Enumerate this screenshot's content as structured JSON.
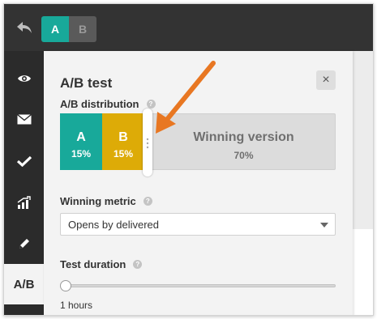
{
  "toolbar": {
    "version_a": "A",
    "version_b": "B"
  },
  "sidebar": {
    "items": [
      {
        "icon": "eye-icon"
      },
      {
        "icon": "envelope-icon"
      },
      {
        "icon": "checkmark-icon"
      },
      {
        "icon": "chart-icon"
      },
      {
        "icon": "pencil-icon"
      },
      {
        "label": "A/B"
      }
    ]
  },
  "panel": {
    "title": "A/B test",
    "close": "×",
    "distribution_label": "A/B distribution",
    "segments": {
      "a_label": "A",
      "a_percent": "15%",
      "b_label": "B",
      "b_percent": "15%",
      "winning_label": "Winning version",
      "winning_percent": "70%"
    },
    "winning_metric_label": "Winning metric",
    "winning_metric_value": "Opens by delivered",
    "test_duration_label": "Test duration",
    "test_duration_value": "1 hours",
    "help_glyph": "?"
  },
  "colors": {
    "accent_a": "#18a99a",
    "accent_b": "#ddab07",
    "annotation_arrow": "#e87722"
  }
}
